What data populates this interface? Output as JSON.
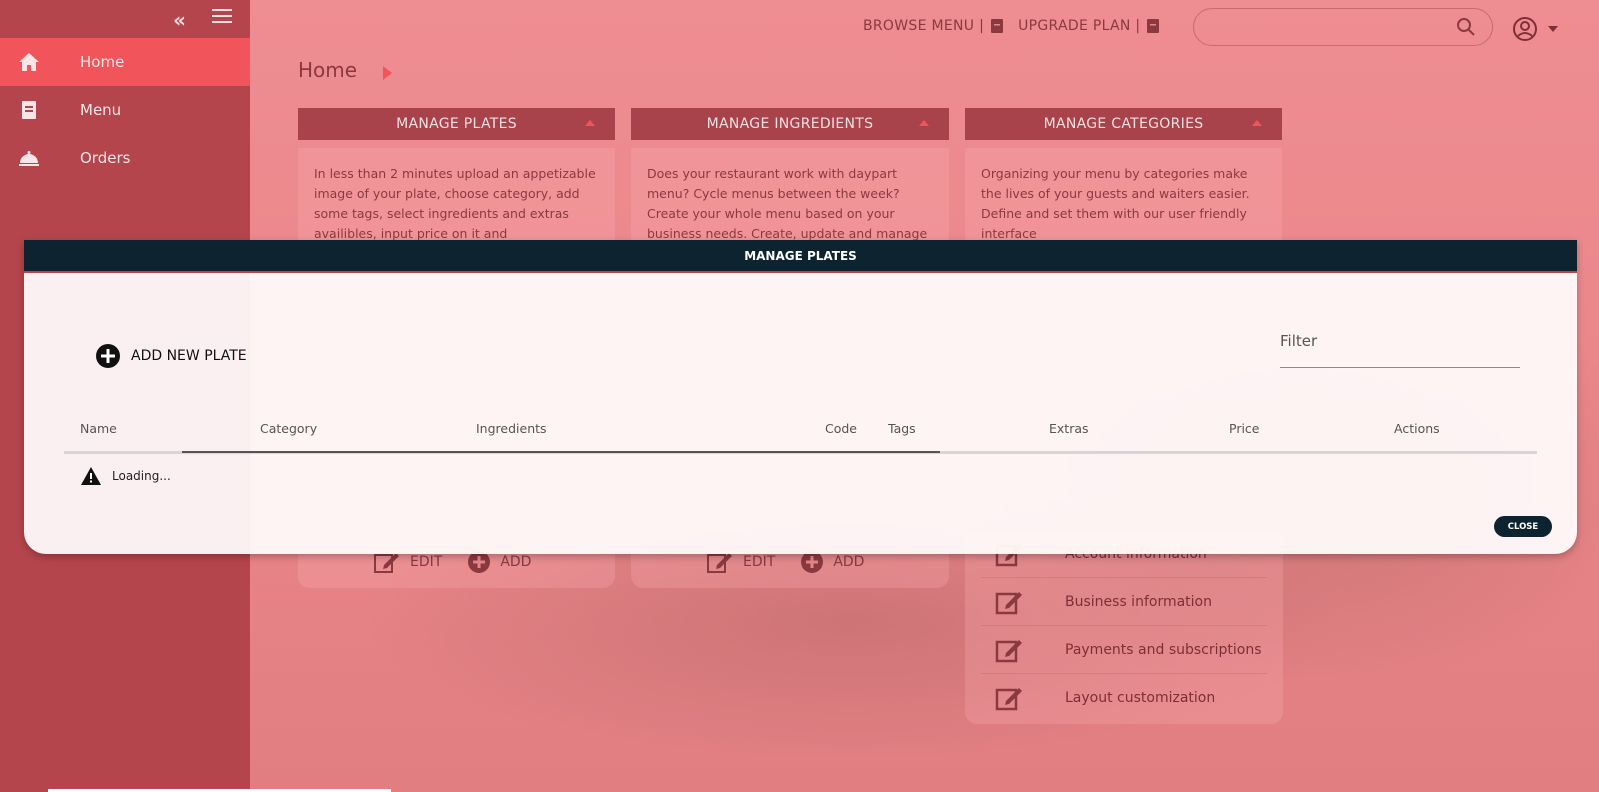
{
  "sidebar": {
    "items": [
      {
        "label": "Home",
        "icon": "home-icon"
      },
      {
        "label": "Menu",
        "icon": "menu-book-icon"
      },
      {
        "label": "Orders",
        "icon": "room-service-icon"
      }
    ]
  },
  "topbar": {
    "browse_menu": "BROWSE MENU |",
    "upgrade_plan": "UPGRADE PLAN |"
  },
  "breadcrumb": "Home",
  "cards": [
    {
      "title": "MANAGE PLATES",
      "text": "In less than 2 minutes upload an appetizable image of your plate, choose category, add some tags, select ingredients and extras availibles, input price on it and"
    },
    {
      "title": "MANAGE INGREDIENTS",
      "text": "Does your restaurant work with daypart menu? Cycle menus between the week? Create your whole menu based on your business needs. Create, update and manage"
    },
    {
      "title": "MANAGE CATEGORIES",
      "text": "Organizing your menu by categories make the lives of your guests and waiters easier. Define and set them with our user friendly interface"
    }
  ],
  "card_actions": {
    "edit": "EDIT",
    "add": "ADD"
  },
  "settings_rows": [
    "Account information",
    "Business information",
    "Payments and subscriptions",
    "Layout customization"
  ],
  "modal": {
    "title": "MANAGE PLATES",
    "add_label": "ADD NEW PLATE",
    "filter_placeholder": "Filter",
    "columns": [
      "Name",
      "Category",
      "Ingredients",
      "Code",
      "Tags",
      "Extras",
      "Price",
      "Actions"
    ],
    "loading": "Loading...",
    "close": "CLOSE"
  },
  "colors": {
    "accent": "#f2545b",
    "sidebar": "#b5454c",
    "modal_header": "#0d2330"
  }
}
